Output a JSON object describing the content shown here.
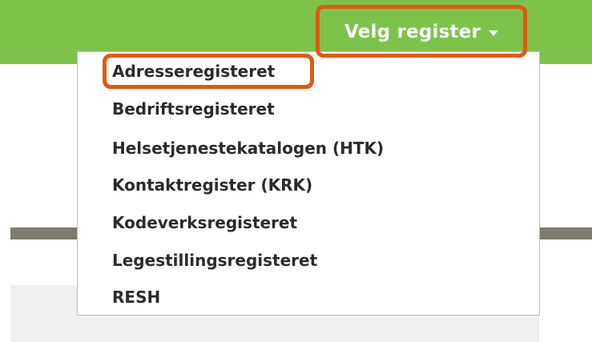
{
  "header": {
    "button_label": "Velg register",
    "accent_color": "#7dc34b"
  },
  "highlight_color": "#e05a12",
  "menu": {
    "items": [
      {
        "label": "Adresseregisteret"
      },
      {
        "label": "Bedriftsregisteret"
      },
      {
        "label": "Helsetjenestekatalogen (HTK)"
      },
      {
        "label": "Kontaktregister (KRK)"
      },
      {
        "label": "Kodeverksregisteret"
      },
      {
        "label": "Legestillingsregisteret"
      },
      {
        "label": "RESH"
      }
    ]
  }
}
